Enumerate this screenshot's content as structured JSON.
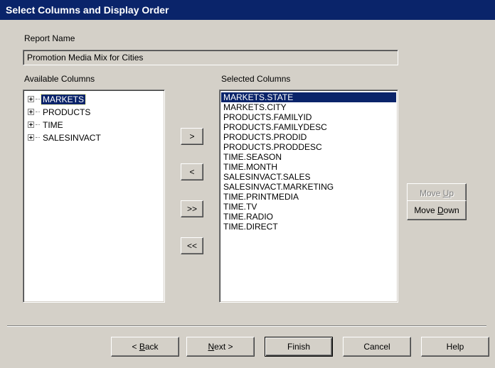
{
  "window": {
    "title": "Select Columns and Display Order"
  },
  "report": {
    "label": "Report Name",
    "value": "Promotion Media Mix for Cities"
  },
  "available": {
    "label": "Available Columns",
    "items": [
      {
        "label": "MARKETS",
        "selected": true
      },
      {
        "label": "PRODUCTS",
        "selected": false
      },
      {
        "label": "TIME",
        "selected": false
      },
      {
        "label": "SALESINVACT",
        "selected": false
      }
    ]
  },
  "selected": {
    "label": "Selected Columns",
    "items": [
      "MARKETS.STATE",
      "MARKETS.CITY",
      "PRODUCTS.FAMILYID",
      "PRODUCTS.FAMILYDESC",
      "PRODUCTS.PRODID",
      "PRODUCTS.PRODDESC",
      "TIME.SEASON",
      "TIME.MONTH",
      "SALESINVACT.SALES",
      "SALESINVACT.MARKETING",
      "TIME.PRINTMEDIA",
      "TIME.TV",
      "TIME.RADIO",
      "TIME.DIRECT"
    ],
    "selected_index": 0
  },
  "transfer": {
    "add": ">",
    "remove": "<",
    "add_all": ">>",
    "remove_all": "<<"
  },
  "order": {
    "move_up_pre": "Move ",
    "move_up_key": "U",
    "move_up_post": "p",
    "move_down_pre": "Move ",
    "move_down_key": "D",
    "move_down_post": "own"
  },
  "footer": {
    "back_pre": "< ",
    "back_key": "B",
    "back_post": "ack",
    "next_key": "N",
    "next_post": "ext >",
    "finish": "Finish",
    "cancel": "Cancel",
    "help": "Help"
  }
}
